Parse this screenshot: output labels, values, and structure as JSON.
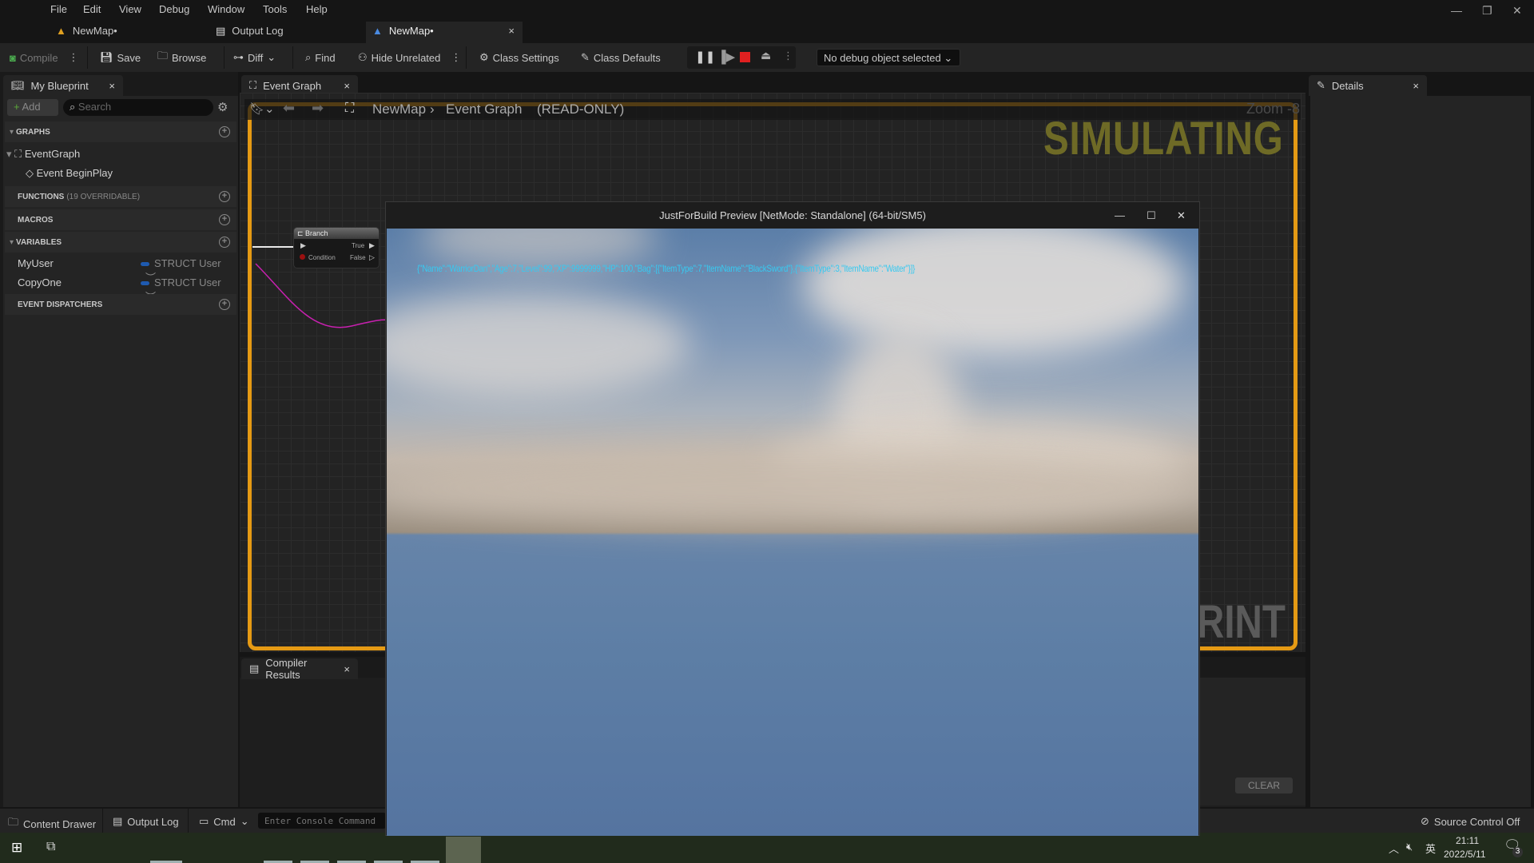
{
  "menu": [
    "File",
    "Edit",
    "View",
    "Debug",
    "Window",
    "Tools",
    "Help"
  ],
  "doc_tabs": [
    {
      "label": "NewMap•",
      "icon": "level-icon"
    },
    {
      "label": "Output Log",
      "icon": "log-icon"
    },
    {
      "label": "NewMap•",
      "icon": "blueprint-icon",
      "active": true
    }
  ],
  "toolbar": {
    "compile": "Compile",
    "save": "Save",
    "browse": "Browse",
    "diff": "Diff",
    "find": "Find",
    "hide_unrelated": "Hide Unrelated",
    "class_settings": "Class Settings",
    "class_defaults": "Class Defaults",
    "debug_object": "No debug object selected"
  },
  "my_blueprint": {
    "tab_label": "My Blueprint",
    "add_label": "Add",
    "search_placeholder": "Search",
    "sections": {
      "graphs": "GRAPHS",
      "functions": "FUNCTIONS",
      "functions_note": "(19 OVERRIDABLE)",
      "macros": "MACROS",
      "variables": "VARIABLES",
      "event_dispatchers": "EVENT DISPATCHERS"
    },
    "graphs": [
      {
        "label": "EventGraph",
        "children": [
          "Event BeginPlay"
        ]
      }
    ],
    "variables": [
      {
        "name": "MyUser",
        "type": "STRUCT User"
      },
      {
        "name": "CopyOne",
        "type": "STRUCT User"
      }
    ]
  },
  "graph": {
    "tab_label": "Event Graph",
    "breadcrumb": [
      "NewMap",
      "Event Graph"
    ],
    "readonly": "(READ-ONLY)",
    "zoom": "Zoom -8",
    "watermark_top": "SIMULATING",
    "watermark_bottom": "RINT",
    "node": {
      "title": "Branch",
      "condition": "Condition",
      "true": "True",
      "false": "False"
    }
  },
  "details": {
    "tab_label": "Details"
  },
  "compiler_results": {
    "tab_label": "Compiler Results",
    "clear": "CLEAR"
  },
  "statusbar": {
    "content_drawer": "Content Drawer",
    "output_log": "Output Log",
    "cmd": "Cmd",
    "console_placeholder": "Enter Console Command",
    "source_control": "Source Control Off"
  },
  "preview": {
    "title": "JustForBuild Preview [NetMode: Standalone]  (64-bit/SM5)",
    "overlay_text": "{\"Name\":\"WarriorDan\",\"Age\":7,\"Level\":99,\"XP\":9999999,\"HP\":100,\"Bag\":[{\"ItemType\":7,\"ItemName\":\"BlackSword\"},{\"ItemType\":3,\"ItemName\":\"Water\"}]}"
  },
  "taskbar": {
    "time": "21:11",
    "date": "2022/5/11",
    "ime": "英",
    "notifications": "3"
  },
  "colors": {
    "simulating_border": "#e59a14",
    "overlay_text": "#38c9f0",
    "struct_pin": "#1e5ab0"
  }
}
